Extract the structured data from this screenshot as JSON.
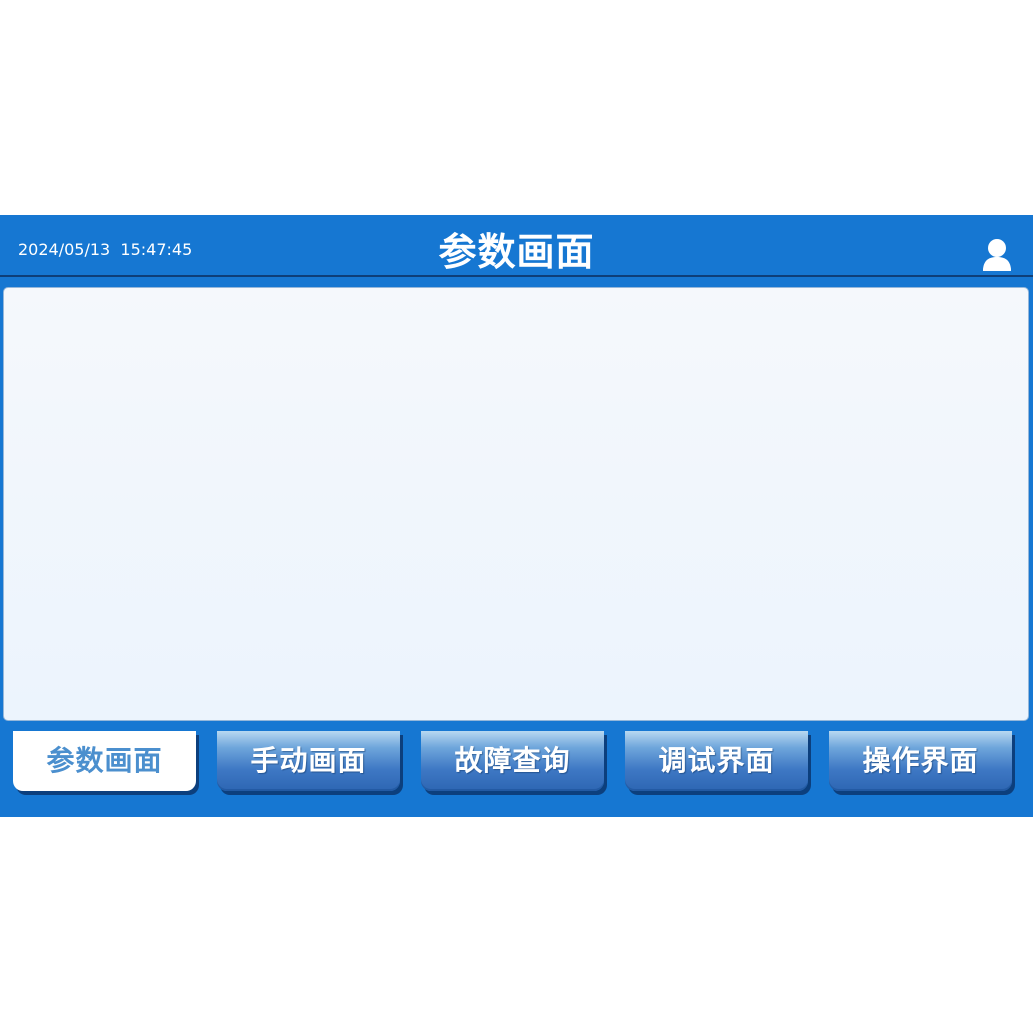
{
  "header": {
    "date": "2024/05/13",
    "time": "15:47:45",
    "title": "参数画面",
    "user_icon": "user-icon"
  },
  "tabs": [
    {
      "label": "参数画面",
      "active": true
    },
    {
      "label": "手动画面",
      "active": false
    },
    {
      "label": "故障查询",
      "active": false
    },
    {
      "label": "调试界面",
      "active": false
    },
    {
      "label": "操作界面",
      "active": false
    }
  ],
  "colors": {
    "frame": "#1677d2",
    "header_border": "#0e3f79",
    "content_bg": "#f5f8fc",
    "active_tab_text": "#4b8fce",
    "inactive_tab_text": "#ffffff"
  }
}
